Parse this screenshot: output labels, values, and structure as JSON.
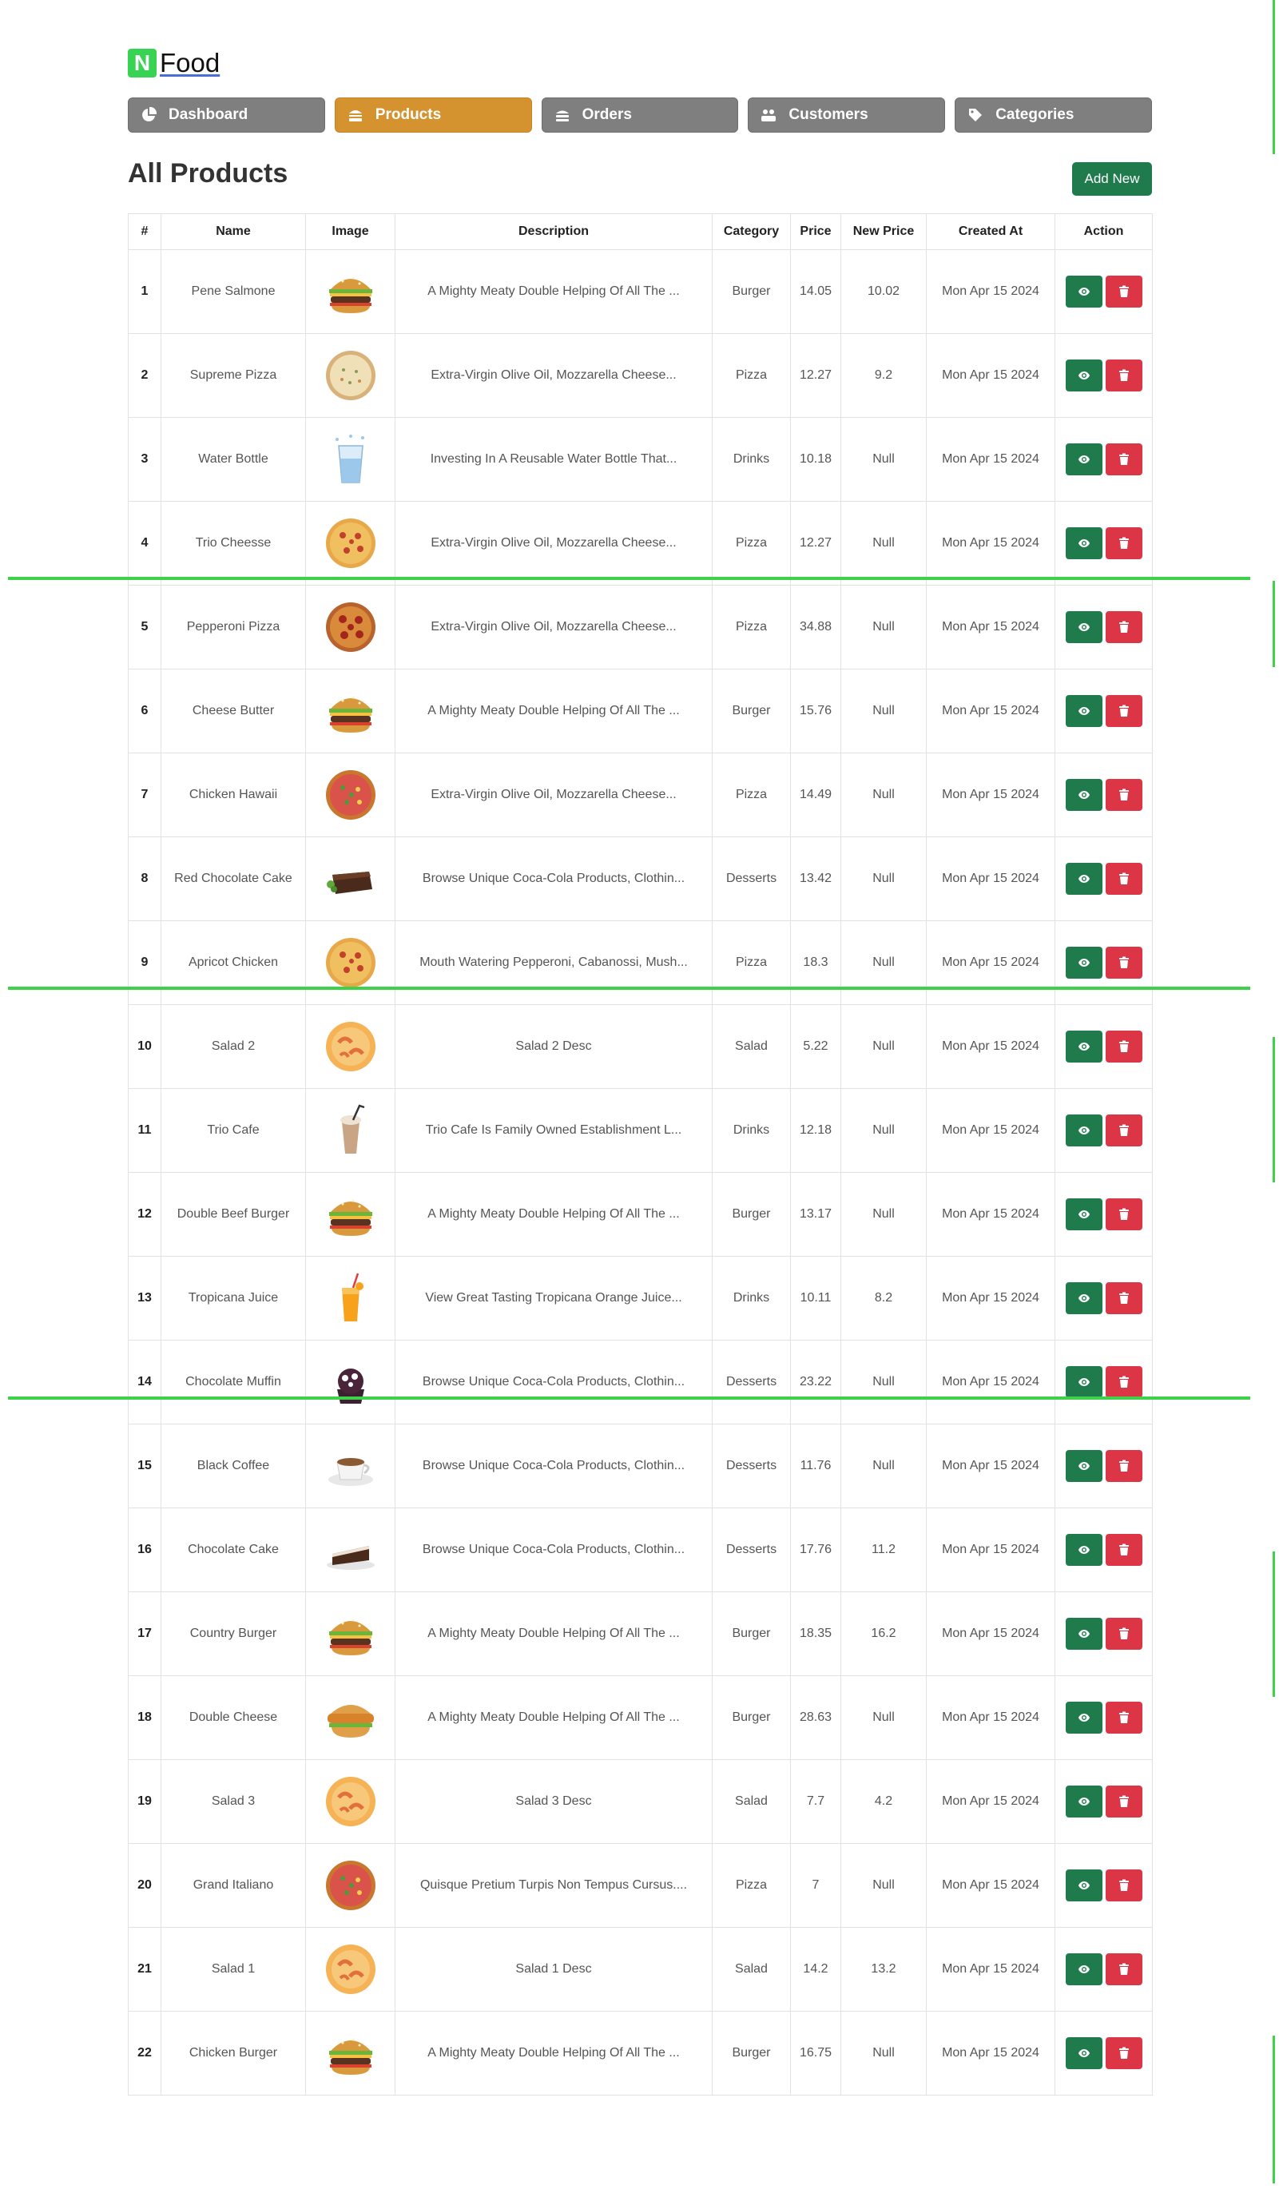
{
  "brand": {
    "mark": "N",
    "name": "Food"
  },
  "nav": [
    {
      "label": "Dashboard",
      "icon": "pie-chart-icon",
      "active": false
    },
    {
      "label": "Products",
      "icon": "burger-icon",
      "active": true
    },
    {
      "label": "Orders",
      "icon": "stack-icon",
      "active": false
    },
    {
      "label": "Customers",
      "icon": "users-icon",
      "active": false
    },
    {
      "label": "Categories",
      "icon": "tag-icon",
      "active": false
    }
  ],
  "page": {
    "title": "All Products",
    "add_label": "Add New"
  },
  "table": {
    "headers": [
      "#",
      "Name",
      "Image",
      "Description",
      "Category",
      "Price",
      "New Price",
      "Created At",
      "Action"
    ],
    "rows": [
      {
        "id": "1",
        "name": "Pene Salmone",
        "image": "burger",
        "description": "A Mighty Meaty Double Helping Of All The ...",
        "category": "Burger",
        "price": "14.05",
        "new_price": "10.02",
        "created": "Mon Apr 15 2024"
      },
      {
        "id": "2",
        "name": "Supreme Pizza",
        "image": "pizza-white",
        "description": "Extra-Virgin Olive Oil, Mozzarella Cheese...",
        "category": "Pizza",
        "price": "12.27",
        "new_price": "9.2",
        "created": "Mon Apr 15 2024"
      },
      {
        "id": "3",
        "name": "Water Bottle",
        "image": "water",
        "description": "Investing In A Reusable Water Bottle That...",
        "category": "Drinks",
        "price": "10.18",
        "new_price": "Null",
        "created": "Mon Apr 15 2024"
      },
      {
        "id": "4",
        "name": "Trio Cheesse",
        "image": "pizza",
        "description": "Extra-Virgin Olive Oil, Mozzarella Cheese...",
        "category": "Pizza",
        "price": "12.27",
        "new_price": "Null",
        "created": "Mon Apr 15 2024"
      },
      {
        "id": "5",
        "name": "Pepperoni Pizza",
        "image": "pizza-pepperoni",
        "description": "Extra-Virgin Olive Oil, Mozzarella Cheese...",
        "category": "Pizza",
        "price": "34.88",
        "new_price": "Null",
        "created": "Mon Apr 15 2024"
      },
      {
        "id": "6",
        "name": "Cheese Butter",
        "image": "burger",
        "description": "A Mighty Meaty Double Helping Of All The ...",
        "category": "Burger",
        "price": "15.76",
        "new_price": "Null",
        "created": "Mon Apr 15 2024"
      },
      {
        "id": "7",
        "name": "Chicken Hawaii",
        "image": "pizza-veg",
        "description": "Extra-Virgin Olive Oil, Mozzarella Cheese...",
        "category": "Pizza",
        "price": "14.49",
        "new_price": "Null",
        "created": "Mon Apr 15 2024"
      },
      {
        "id": "8",
        "name": "Red Chocolate Cake",
        "image": "brownie",
        "description": "Browse Unique Coca-Cola Products, Clothin...",
        "category": "Desserts",
        "price": "13.42",
        "new_price": "Null",
        "created": "Mon Apr 15 2024"
      },
      {
        "id": "9",
        "name": "Apricot Chicken",
        "image": "pizza",
        "description": "Mouth Watering Pepperoni, Cabanossi, Mush...",
        "category": "Pizza",
        "price": "18.3",
        "new_price": "Null",
        "created": "Mon Apr 15 2024"
      },
      {
        "id": "10",
        "name": "Salad 2",
        "image": "shrimp",
        "description": "Salad 2 Desc",
        "category": "Salad",
        "price": "5.22",
        "new_price": "Null",
        "created": "Mon Apr 15 2024"
      },
      {
        "id": "11",
        "name": "Trio Cafe",
        "image": "shake",
        "description": "Trio Cafe Is Family Owned Establishment L...",
        "category": "Drinks",
        "price": "12.18",
        "new_price": "Null",
        "created": "Mon Apr 15 2024"
      },
      {
        "id": "12",
        "name": "Double Beef Burger",
        "image": "burger",
        "description": "A Mighty Meaty Double Helping Of All The ...",
        "category": "Burger",
        "price": "13.17",
        "new_price": "Null",
        "created": "Mon Apr 15 2024"
      },
      {
        "id": "13",
        "name": "Tropicana Juice",
        "image": "juice",
        "description": "View Great Tasting Tropicana Orange Juice...",
        "category": "Drinks",
        "price": "10.11",
        "new_price": "8.2",
        "created": "Mon Apr 15 2024"
      },
      {
        "id": "14",
        "name": "Chocolate Muffin",
        "image": "muffin",
        "description": "Browse Unique Coca-Cola Products, Clothin...",
        "category": "Desserts",
        "price": "23.22",
        "new_price": "Null",
        "created": "Mon Apr 15 2024"
      },
      {
        "id": "15",
        "name": "Black Coffee",
        "image": "coffee",
        "description": "Browse Unique Coca-Cola Products, Clothin...",
        "category": "Desserts",
        "price": "11.76",
        "new_price": "Null",
        "created": "Mon Apr 15 2024"
      },
      {
        "id": "16",
        "name": "Chocolate Cake",
        "image": "cake-slice",
        "description": "Browse Unique Coca-Cola Products, Clothin...",
        "category": "Desserts",
        "price": "17.76",
        "new_price": "11.2",
        "created": "Mon Apr 15 2024"
      },
      {
        "id": "17",
        "name": "Country Burger",
        "image": "burger",
        "description": "A Mighty Meaty Double Helping Of All The ...",
        "category": "Burger",
        "price": "18.35",
        "new_price": "16.2",
        "created": "Mon Apr 15 2024"
      },
      {
        "id": "18",
        "name": "Double Cheese",
        "image": "burger-chicken",
        "description": "A Mighty Meaty Double Helping Of All The ...",
        "category": "Burger",
        "price": "28.63",
        "new_price": "Null",
        "created": "Mon Apr 15 2024"
      },
      {
        "id": "19",
        "name": "Salad 3",
        "image": "shrimp",
        "description": "Salad 3 Desc",
        "category": "Salad",
        "price": "7.7",
        "new_price": "4.2",
        "created": "Mon Apr 15 2024"
      },
      {
        "id": "20",
        "name": "Grand Italiano",
        "image": "pizza-veg",
        "description": "Quisque Pretium Turpis Non Tempus Cursus....",
        "category": "Pizza",
        "price": "7",
        "new_price": "Null",
        "created": "Mon Apr 15 2024"
      },
      {
        "id": "21",
        "name": "Salad 1",
        "image": "shrimp",
        "description": "Salad 1 Desc",
        "category": "Salad",
        "price": "14.2",
        "new_price": "13.2",
        "created": "Mon Apr 15 2024"
      },
      {
        "id": "22",
        "name": "Chicken Burger",
        "image": "burger",
        "description": "A Mighty Meaty Double Helping Of All The ...",
        "category": "Burger",
        "price": "16.75",
        "new_price": "Null",
        "created": "Mon Apr 15 2024"
      }
    ]
  },
  "colors": {
    "nav_default": "#7f7f7f",
    "nav_active": "#d4932e",
    "primary_green": "#1f7a4c",
    "danger_red": "#dc3545",
    "logo_green": "#39d353",
    "marker_green": "#3fd14a"
  }
}
